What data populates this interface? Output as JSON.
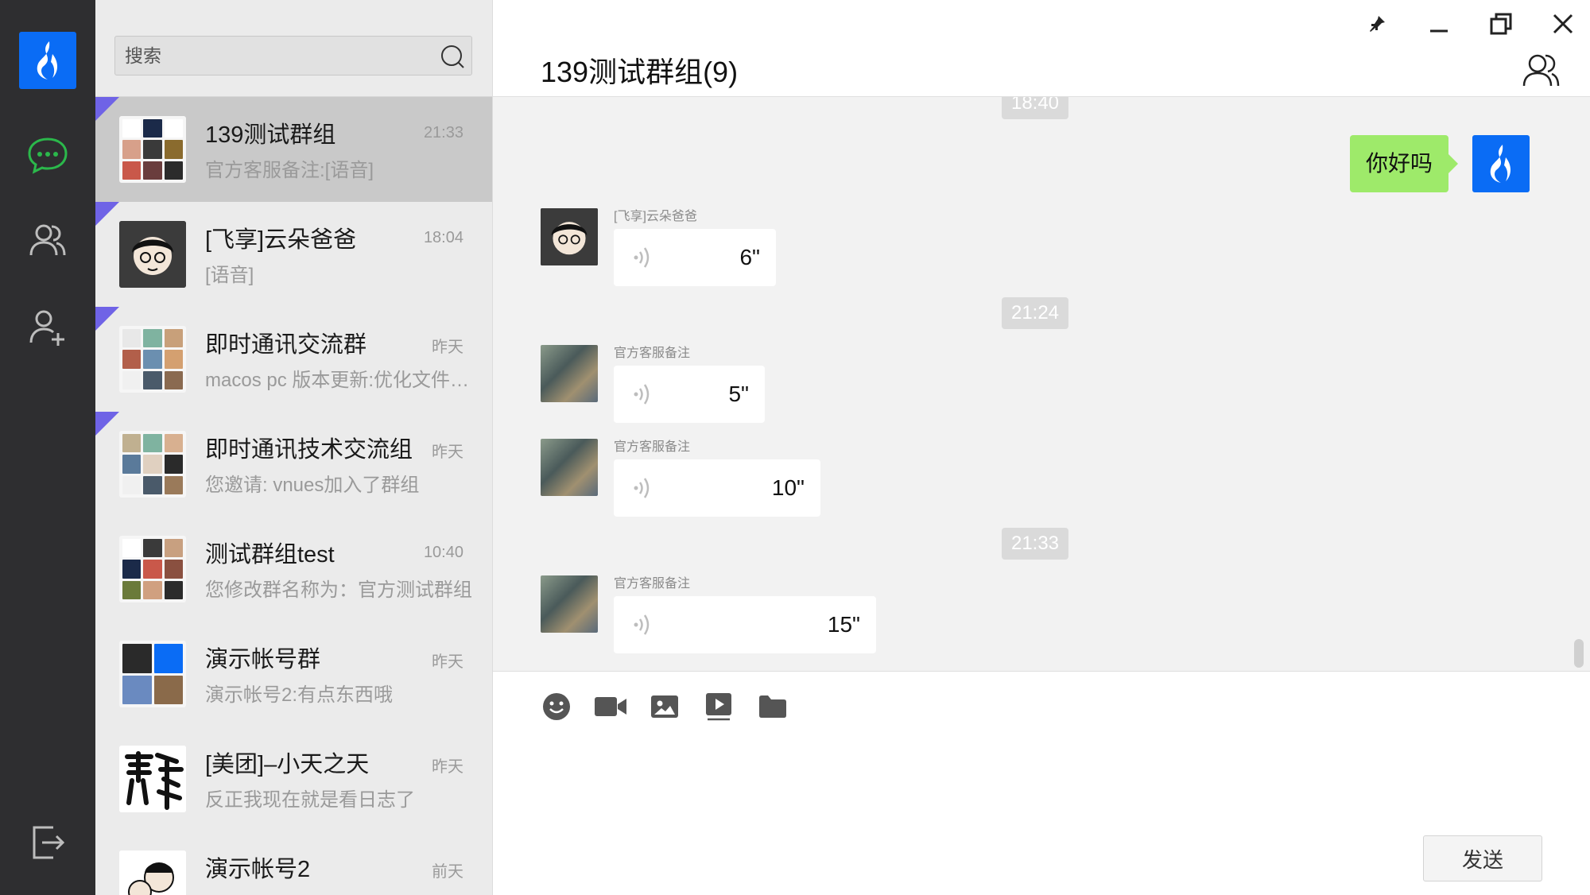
{
  "rail": {
    "logo_icon": "flame-logo-icon",
    "items": [
      {
        "icon": "chat-bubble-icon",
        "active": true
      },
      {
        "icon": "contacts-icon",
        "active": false
      },
      {
        "icon": "add-contact-icon",
        "active": false
      }
    ],
    "logout_icon": "logout-icon"
  },
  "search": {
    "placeholder": "搜索",
    "icon": "search-icon"
  },
  "conversations": [
    {
      "name": "139测试群组",
      "time": "21:33",
      "preview": "官方客服备注:[语音]",
      "active": true,
      "pinned": true
    },
    {
      "name": "[飞享]云朵爸爸",
      "time": "18:04",
      "preview": "[语音]",
      "active": false,
      "pinned": true
    },
    {
      "name": "即时通讯交流群",
      "time": "昨天",
      "preview": "macos pc 版本更新:优化文件上传",
      "active": false,
      "pinned": true
    },
    {
      "name": "即时通讯技术交流组",
      "time": "昨天",
      "preview": "您邀请: vnues加入了群组",
      "active": false,
      "pinned": true
    },
    {
      "name": "测试群组test",
      "time": "10:40",
      "preview": "您修改群名称为：官方测试群组",
      "active": false,
      "pinned": false
    },
    {
      "name": "演示帐号群",
      "time": "昨天",
      "preview": "演示帐号2:有点东西哦",
      "active": false,
      "pinned": false
    },
    {
      "name": "[美团]–小天之天",
      "time": "昨天",
      "preview": "反正我现在就是看日志了",
      "active": false,
      "pinned": false
    },
    {
      "name": "演示帐号2",
      "time": "前天",
      "preview": "",
      "active": false,
      "pinned": false
    }
  ],
  "chat": {
    "title": "139测试群组(9)",
    "window_controls": [
      "pin-icon",
      "minimize-icon",
      "restore-icon",
      "close-icon"
    ],
    "members_icon": "group-members-icon",
    "timestamps": [
      "18:40",
      "21:24",
      "21:33"
    ],
    "outgoing": {
      "text": "你好吗"
    },
    "voice_messages": [
      {
        "sender": "[飞享]云朵爸爸",
        "duration": "6\""
      },
      {
        "sender": "官方客服备注",
        "duration": "5\""
      },
      {
        "sender": "官方客服备注",
        "duration": "10\""
      },
      {
        "sender": "官方客服备注",
        "duration": "15\""
      }
    ]
  },
  "composer": {
    "tools": [
      "emoji-icon",
      "video-call-icon",
      "image-icon",
      "video-file-icon",
      "folder-icon"
    ],
    "send_label": "发送"
  },
  "colors": {
    "accent": "#0a6cf5",
    "outgoing_bubble": "#9eea6a",
    "rail_bg": "#2e2e30",
    "active_green": "#2bb84b",
    "pin_marker": "#6f63e6"
  }
}
